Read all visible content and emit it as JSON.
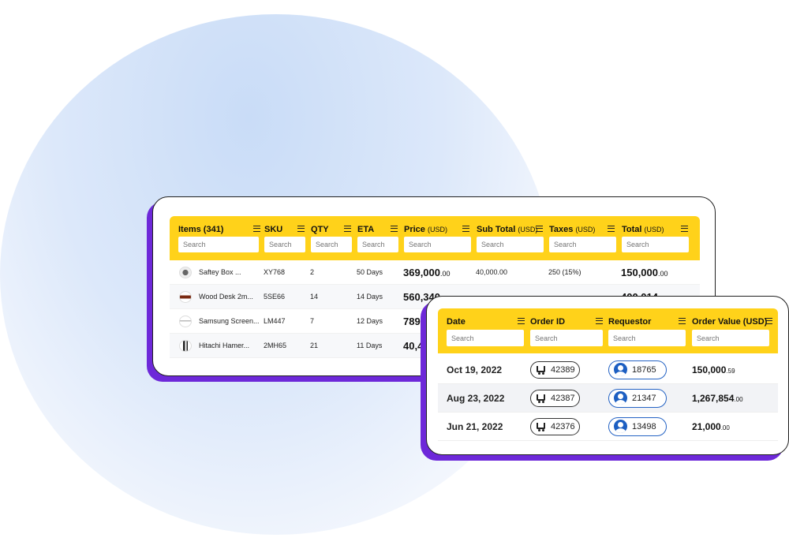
{
  "colors": {
    "accent": "#ffd21a",
    "shadow": "#6d28d9",
    "requestor_border": "#2563c4"
  },
  "items_table": {
    "columns": [
      {
        "title": "Items (341)",
        "unit": "",
        "placeholder": "Search"
      },
      {
        "title": "SKU",
        "unit": "",
        "placeholder": "Search"
      },
      {
        "title": "QTY",
        "unit": "",
        "placeholder": "Search"
      },
      {
        "title": "ETA",
        "unit": "",
        "placeholder": "Search"
      },
      {
        "title": "Price",
        "unit": "(USD)",
        "placeholder": "Search"
      },
      {
        "title": "Sub Total",
        "unit": "(USD)",
        "placeholder": "Search"
      },
      {
        "title": "Taxes",
        "unit": "(USD)",
        "placeholder": "Search"
      },
      {
        "title": "Total",
        "unit": "(USD)",
        "placeholder": "Search"
      }
    ],
    "rows": [
      {
        "item": "Saftey Box ...",
        "sku": "XY768",
        "qty": "2",
        "eta": "50 Days",
        "price_main": "369,000",
        "price_dec": ".00",
        "subtotal": "40,000.00",
        "taxes": "250 (15%)",
        "total_main": "150,000",
        "total_dec": ".00"
      },
      {
        "item": "Wood Desk 2m...",
        "sku": "5SE66",
        "qty": "14",
        "eta": "14 Days",
        "price_main": "560,340",
        "price_dec": "",
        "subtotal": "",
        "taxes": "",
        "total_main": "400,014",
        "total_dec": ""
      },
      {
        "item": "Samsung Screen...",
        "sku": "LM447",
        "qty": "7",
        "eta": "12 Days",
        "price_main": "789,",
        "price_dec": "",
        "subtotal": "",
        "taxes": "",
        "total_main": "",
        "total_dec": ""
      },
      {
        "item": "Hitachi Hamer...",
        "sku": "2MH65",
        "qty": "21",
        "eta": "11 Days",
        "price_main": "40,4",
        "price_dec": "",
        "subtotal": "",
        "taxes": "",
        "total_main": "",
        "total_dec": ""
      }
    ]
  },
  "orders_table": {
    "columns": [
      {
        "title": "Date",
        "placeholder": "Search"
      },
      {
        "title": "Order ID",
        "placeholder": "Search"
      },
      {
        "title": "Requestor",
        "placeholder": "Search"
      },
      {
        "title": "Order Value (USD)",
        "placeholder": "Search"
      }
    ],
    "rows": [
      {
        "date": "Oct 19, 2022",
        "order_id": "42389",
        "requestor": "18765",
        "value_main": "150,000",
        "value_dec": ".59"
      },
      {
        "date": "Aug 23, 2022",
        "order_id": "42387",
        "requestor": "21347",
        "value_main": "1,267,854",
        "value_dec": ".00"
      },
      {
        "date": "Jun 21, 2022",
        "order_id": "42376",
        "requestor": "13498",
        "value_main": "21,000",
        "value_dec": ".00"
      }
    ]
  }
}
